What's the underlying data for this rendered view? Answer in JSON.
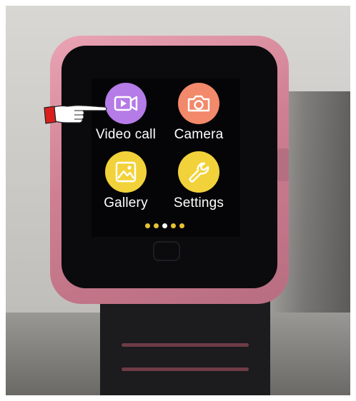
{
  "apps": [
    {
      "label": "Video call",
      "icon": "video-call-icon",
      "color": "#b57be6"
    },
    {
      "label": "Camera",
      "icon": "camera-icon",
      "color": "#f2896a"
    },
    {
      "label": "Gallery",
      "icon": "gallery-icon",
      "color": "#f2d23a"
    },
    {
      "label": "Settings",
      "icon": "settings-icon",
      "color": "#f2d23a"
    }
  ],
  "page_indicator": {
    "count": 5,
    "active_index": 2,
    "dot_color": "#e8c234",
    "active_color": "#ffffff"
  },
  "pointer": {
    "icon": "pointing-hand-icon",
    "cuff_color": "#d9201e",
    "target": "Video call"
  },
  "device": {
    "case_color": "#cf7f92",
    "band_color": "#1c1b1e"
  }
}
